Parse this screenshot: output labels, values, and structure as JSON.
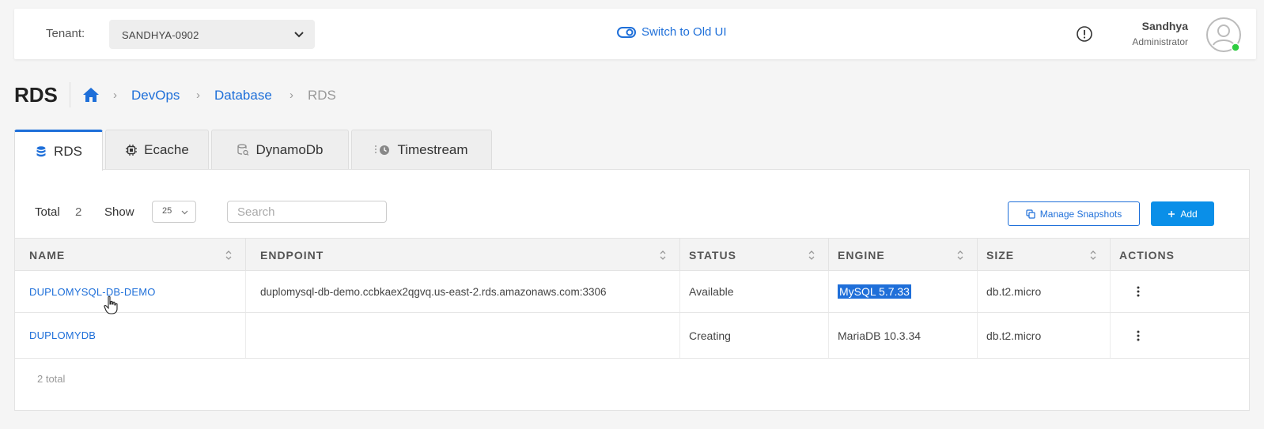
{
  "topbar": {
    "tenant_label": "Tenant:",
    "tenant_value": "SANDHYA-0902",
    "switch_label": "Switch to Old UI",
    "user_name": "Sandhya",
    "user_role": "Administrator"
  },
  "header": {
    "title": "RDS",
    "breadcrumb": [
      "DevOps",
      "Database",
      "RDS"
    ]
  },
  "tabs": [
    {
      "label": "RDS",
      "icon": "database-icon",
      "active": true
    },
    {
      "label": "Ecache",
      "icon": "chip-icon",
      "active": false
    },
    {
      "label": "DynamoDb",
      "icon": "db-search-icon",
      "active": false
    },
    {
      "label": "Timestream",
      "icon": "clock-icon",
      "active": false
    }
  ],
  "toolbar": {
    "total_label": "Total",
    "total_count": "2",
    "show_label": "Show",
    "show_value": "25",
    "search_placeholder": "Search",
    "manage_snapshots_label": "Manage Snapshots",
    "add_label": "Add"
  },
  "table": {
    "columns": [
      "NAME",
      "ENDPOINT",
      "STATUS",
      "ENGINE",
      "SIZE",
      "ACTIONS"
    ],
    "rows": [
      {
        "name": "DUPLOMYSQL-DB-DEMO",
        "endpoint": "duplomysql-db-demo.ccbkaex2qgvq.us-east-2.rds.amazonaws.com:3306",
        "status": "Available",
        "engine": "MySQL 5.7.33",
        "size": "db.t2.micro"
      },
      {
        "name": "DUPLOMYDB",
        "endpoint": "",
        "status": "Creating",
        "engine": "MariaDB 10.3.34",
        "size": "db.t2.micro"
      }
    ],
    "footer": "2 total"
  },
  "colors": {
    "accent": "#1e6fd9",
    "add_button": "#0a8fe8",
    "online": "#2ecc40"
  }
}
